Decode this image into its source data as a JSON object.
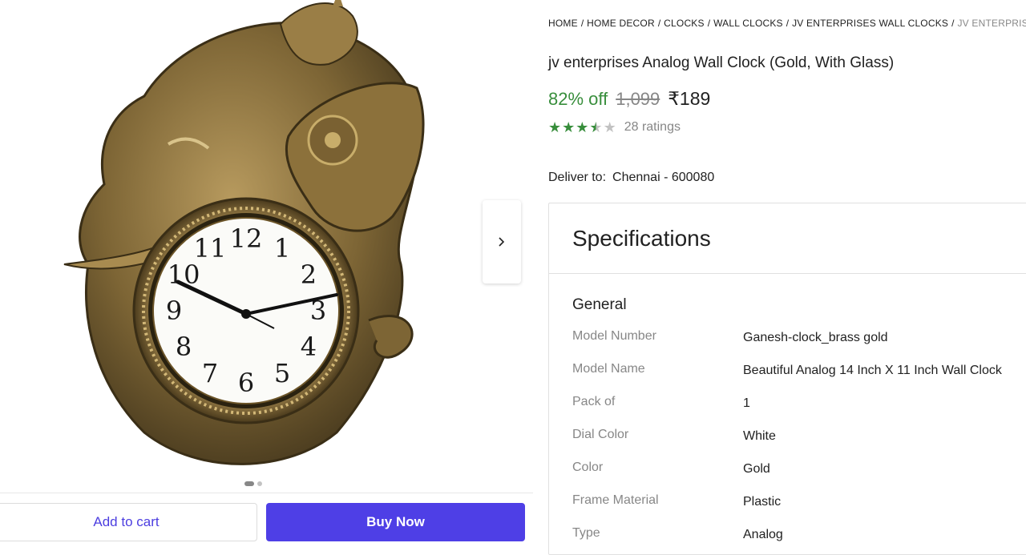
{
  "breadcrumb": [
    "HOME",
    "HOME DECOR",
    "CLOCKS",
    "WALL CLOCKS",
    "JV ENTERPRISES WALL CLOCKS",
    "JV ENTERPRISES A"
  ],
  "product": {
    "title": "jv enterprises Analog Wall Clock (Gold, With Glass)",
    "discount": "82% off",
    "mrp": "1,099",
    "price": "₹189",
    "rating": 3.5,
    "ratings_count": "28 ratings"
  },
  "delivery": {
    "label": "Deliver to:",
    "location": "Chennai - 600080"
  },
  "carousel": {
    "current": 1,
    "total": 2
  },
  "actions": {
    "add_to_cart": "Add to cart",
    "buy_now": "Buy Now"
  },
  "colors": {
    "accent": "#4e3fe6",
    "discount_green": "#388e3c",
    "muted": "#878787"
  },
  "specifications": {
    "heading": "Specifications",
    "group": "General",
    "rows": [
      {
        "key": "Model Number",
        "value": "Ganesh-clock_brass gold"
      },
      {
        "key": "Model Name",
        "value": "Beautiful Analog 14 Inch X 11 Inch Wall Clock"
      },
      {
        "key": "Pack of",
        "value": "1"
      },
      {
        "key": "Dial Color",
        "value": "White"
      },
      {
        "key": "Color",
        "value": "Gold"
      },
      {
        "key": "Frame Material",
        "value": "Plastic"
      },
      {
        "key": "Type",
        "value": "Analog"
      }
    ]
  },
  "clock_numerals": [
    "12",
    "1",
    "2",
    "3",
    "4",
    "5",
    "6",
    "7",
    "8",
    "9",
    "10",
    "11"
  ]
}
